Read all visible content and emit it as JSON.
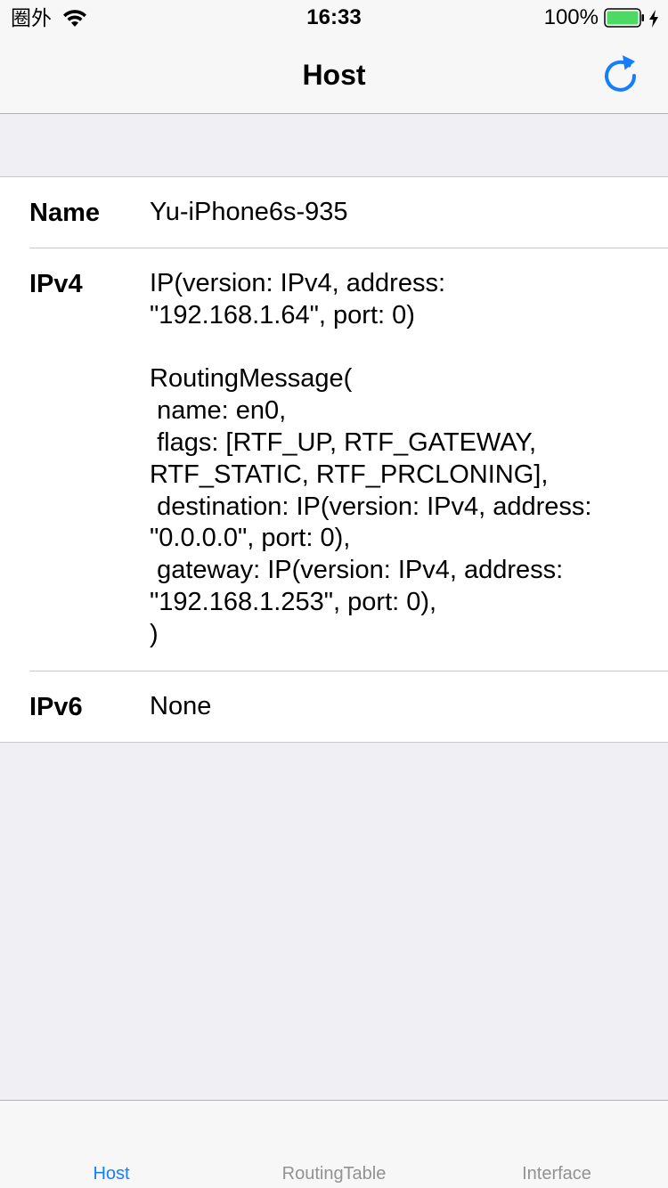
{
  "status_bar": {
    "carrier": "圈外",
    "time": "16:33",
    "battery_percent": "100%",
    "wifi_icon": "wifi-icon",
    "battery_icon": "battery-icon",
    "charge_icon": "charging-bolt-icon"
  },
  "nav": {
    "title": "Host",
    "refresh_icon": "refresh-icon",
    "accent_color": "#157efb"
  },
  "host_table": {
    "rows": [
      {
        "key": "Name",
        "value": "Yu-iPhone6s-935"
      },
      {
        "key": "IPv4",
        "value": "IP(version: IPv4, address:\n\"192.168.1.64\", port: 0)\n\nRoutingMessage(\n name: en0,\n flags: [RTF_UP, RTF_GATEWAY,\nRTF_STATIC, RTF_PRCLONING],\n destination: IP(version: IPv4, address:\n\"0.0.0.0\", port: 0),\n gateway: IP(version: IPv4, address:\n\"192.168.1.253\", port: 0),\n)"
      },
      {
        "key": "IPv6",
        "value": "None"
      }
    ]
  },
  "tab_bar": {
    "tabs": [
      {
        "label": "Host",
        "active": true
      },
      {
        "label": "RoutingTable",
        "active": false
      },
      {
        "label": "Interface",
        "active": false
      }
    ],
    "active_color": "#157efb",
    "inactive_color": "#929292"
  }
}
